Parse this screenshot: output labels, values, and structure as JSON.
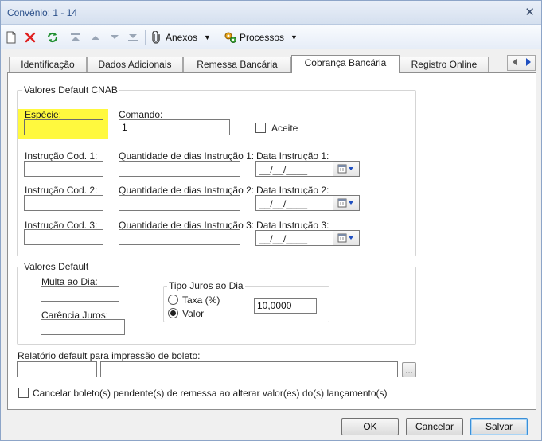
{
  "window": {
    "title": "Convênio: 1 - 14"
  },
  "toolbar": {
    "attachments_label": "Anexos",
    "processes_label": "Processos"
  },
  "tabs": [
    {
      "label": "Identificação"
    },
    {
      "label": "Dados Adicionais"
    },
    {
      "label": "Remessa Bancária"
    },
    {
      "label": "Cobrança Bancária"
    },
    {
      "label": "Registro Online"
    }
  ],
  "cnab": {
    "title": "Valores Default CNAB",
    "especie_label": "Espécie:",
    "especie_value": "",
    "comando_label": "Comando:",
    "comando_value": "1",
    "aceite_label": "Aceite",
    "instr1_label": "Instrução Cod. 1:",
    "instr2_label": "Instrução Cod. 2:",
    "instr3_label": "Instrução Cod. 3:",
    "qtd1_label": "Quantidade de dias Instrução 1:",
    "qtd2_label": "Quantidade de dias Instrução 2:",
    "qtd3_label": "Quantidade de dias Instrução 3:",
    "data1_label": "Data Instrução 1:",
    "data2_label": "Data Instrução 2:",
    "data3_label": "Data Instrução 3:",
    "date_mask": "__/__/____"
  },
  "defaults": {
    "title": "Valores Default",
    "multa_label": "Multa ao Dia:",
    "carencia_label": "Carência Juros:",
    "tipo_juros_title": "Tipo Juros ao Dia",
    "taxa_label": "Taxa (%)",
    "valor_label": "Valor",
    "juros_value": "10,0000"
  },
  "report": {
    "label": "Relatório default para impressão de boleto:",
    "browse_label": "..."
  },
  "cancel_option": {
    "label": "Cancelar boleto(s) pendente(s) de remessa ao alterar valor(es) do(s) lançamento(s)"
  },
  "footer": {
    "ok_label": "OK",
    "cancel_label": "Cancelar",
    "save_label": "Salvar"
  }
}
